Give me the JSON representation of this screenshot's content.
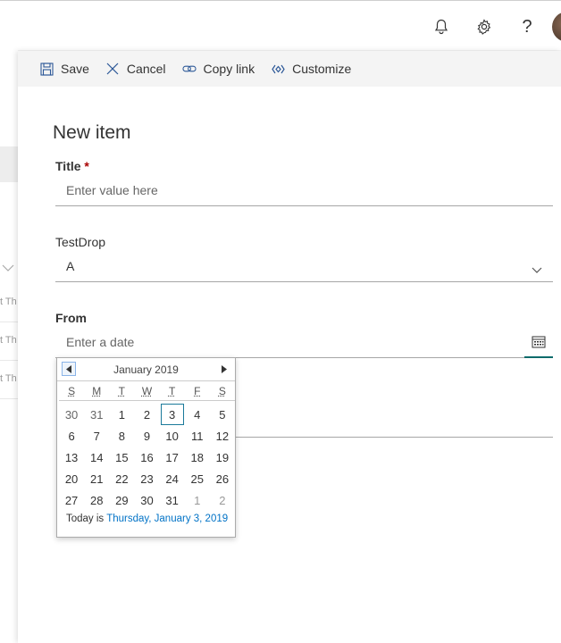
{
  "header": {
    "icons": [
      "bell-icon",
      "gear-icon",
      "help-icon"
    ],
    "help_label": "?"
  },
  "background": {
    "row_text": [
      "t Th",
      "t Th",
      "t Th"
    ],
    "accent_color": "#0a6b6b"
  },
  "commands": {
    "save": "Save",
    "cancel": "Cancel",
    "copy_link": "Copy link",
    "customize": "Customize"
  },
  "form": {
    "title": "New item",
    "fields": {
      "title": {
        "label": "Title",
        "required_mark": "*",
        "placeholder": "Enter value here"
      },
      "testdrop": {
        "label": "TestDrop",
        "value": "A"
      },
      "from": {
        "label": "From",
        "placeholder": "Enter a date"
      }
    }
  },
  "calendar": {
    "month_label": "January 2019",
    "weekdays": [
      "S",
      "M",
      "T",
      "W",
      "T",
      "F",
      "S"
    ],
    "days": [
      [
        "30",
        "31",
        "1",
        "2",
        "3",
        "4",
        "5"
      ],
      [
        "6",
        "7",
        "8",
        "9",
        "10",
        "11",
        "12"
      ],
      [
        "13",
        "14",
        "15",
        "16",
        "17",
        "18",
        "19"
      ],
      [
        "20",
        "21",
        "22",
        "23",
        "24",
        "25",
        "26"
      ],
      [
        "27",
        "28",
        "29",
        "30",
        "31",
        "1",
        "2"
      ]
    ],
    "selected_day": "3",
    "today_prefix": "Today is",
    "today_link": "Thursday, January 3, 2019",
    "accent_color": "#0072c6"
  }
}
